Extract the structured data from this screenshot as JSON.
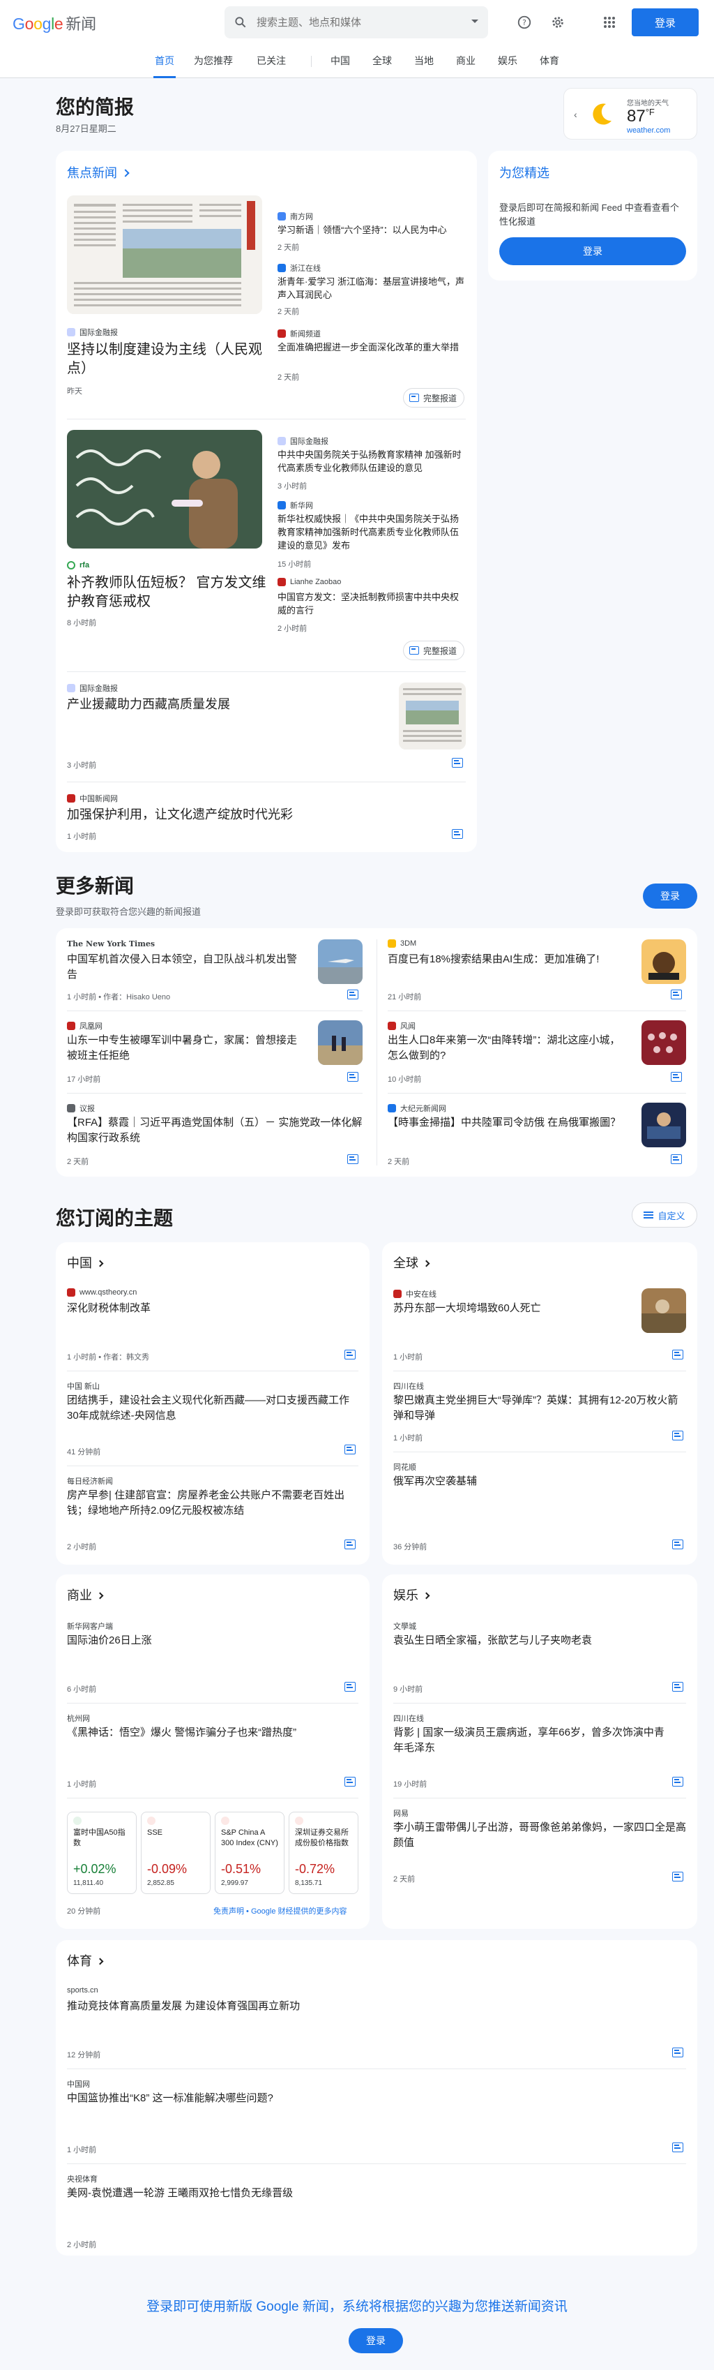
{
  "header": {
    "logo_google": [
      "G",
      "o",
      "o",
      "g",
      "l",
      "e"
    ],
    "logo_news": "新闻",
    "search_placeholder": "搜索主题、地点和媒体",
    "signin": "登录"
  },
  "nav": [
    "首页",
    "为您推荐",
    "已关注",
    "中国",
    "全球",
    "当地",
    "商业",
    "娱乐",
    "体育"
  ],
  "briefing": {
    "title": "您的简报",
    "date": "8月27日星期二"
  },
  "weather": {
    "location": "您当地的天气",
    "temp": "87",
    "unit": "°F",
    "source": "weather.com"
  },
  "top_stories": {
    "link": "焦点新闻",
    "cluster1": {
      "main_source": "国际金融报",
      "main_title": "坚持以制度建设为主线（人民观点）",
      "main_time": "昨天",
      "side": [
        {
          "source": "南方网",
          "title": "学习新语｜领悟“六个坚持”：以人民为中心",
          "time": "2 天前"
        },
        {
          "source": "浙江在线",
          "title": "浙青年·爱学习 浙江临海：基层宣讲接地气，声声入耳润民心",
          "time": "2 天前"
        },
        {
          "source": "新闻频道",
          "title": "全面准确把握进一步全面深化改革的重大举措",
          "time": "2 天前"
        }
      ],
      "coverage": "完整报道"
    },
    "cluster2": {
      "main_source": "rfa",
      "main_title": "补齐教师队伍短板？ 官方发文维护教育惩戒权",
      "main_time": "8 小时前",
      "side": [
        {
          "source": "国际金融报",
          "title": "中共中央国务院关于弘扬教育家精神 加强新时代高素质专业化教师队伍建设的意见",
          "time": "3 小时前"
        },
        {
          "source": "新华网",
          "title": "新华社权威快报｜《中共中央国务院关于弘扬教育家精神加强新时代高素质专业化教师队伍建设的意见》发布",
          "time": "15 小时前"
        },
        {
          "source": "Lianhe Zaobao",
          "title": "中国官方发文：坚决抵制教师损害中共中央权威的言行",
          "time": "2 小时前"
        }
      ],
      "coverage": "完整报道"
    },
    "single1": {
      "source": "国际金融报",
      "title": "产业援藏助力西藏高质量发展",
      "time": "3 小时前"
    },
    "single2": {
      "source": "中国新闻网",
      "title": "加强保护利用，让文化遗产绽放时代光彩",
      "time": "1 小时前"
    }
  },
  "picks": {
    "title": "为您精选",
    "text": "登录后即可在简报和新闻 Feed 中查看查看个性化报道",
    "button": "登录"
  },
  "more_news": {
    "title": "更多新闻",
    "subtitle": "登录即可获取符合您兴趣的新闻报道",
    "button": "登录",
    "items": [
      {
        "source": "The New York Times",
        "title": "中国军机首次侵入日本领空，自卫队战斗机发出警告",
        "time": "1 小时前 • 作者：Hisako Ueno"
      },
      {
        "source": "3DM",
        "title": "百度已有18%搜索结果由AI生成：更加准确了!",
        "time": "21 小时前"
      },
      {
        "source": "凤凰网",
        "title": "山东一中专生被曝军训中暑身亡，家属：曾想接走被班主任拒绝",
        "time": "17 小时前"
      },
      {
        "source": "风闻",
        "title": "出生人口8年来第一次“由降转增”：湖北这座小城，怎么做到的?",
        "time": "10 小时前"
      },
      {
        "source": "议报",
        "title": "【RFA】蔡霞｜习近平再造党国体制（五）－ 实施党政一体化解构国家行政系统",
        "time": "2 天前"
      },
      {
        "source": "大纪元新闻网",
        "title": "【時事金掃描】中共陸軍司令訪俄 在烏俄軍搬圖？",
        "time": "2 天前"
      }
    ]
  },
  "topics": {
    "title": "您订阅的主题",
    "customize": "自定义",
    "china": {
      "title": "中国",
      "items": [
        {
          "source": "www.qstheory.cn",
          "title": "深化财税体制改革",
          "time": "1 小时前 • 作者：韩文秀"
        },
        {
          "source": "中国 新山",
          "title": "团结携手，建设社会主义现代化新西藏——对口支援西藏工作30年成就综述-央网信息",
          "time": "41 分钟前"
        },
        {
          "source": "每日经济新闻",
          "title": "房产早参| 住建部官宣：房屋养老金公共账户不需要老百姓出钱；绿地地产所持2.09亿元股权被冻结",
          "time": "2 小时前"
        }
      ]
    },
    "world": {
      "title": "全球",
      "items": [
        {
          "source": "中安在线",
          "title": "苏丹东部一大坝垮塌致60人死亡",
          "time": "1 小时前"
        },
        {
          "source": "四川在线",
          "title": "黎巴嫩真主党坐拥巨大“导弹库”？英媒：其拥有12-20万枚火箭弹和导弹",
          "time": "1 小时前"
        },
        {
          "source": "同花顺",
          "title": "俄军再次空袭基辅",
          "time": "36 分钟前"
        }
      ]
    },
    "business": {
      "title": "商业",
      "items": [
        {
          "source": "新华网客户端",
          "title": "国际油价26日上涨",
          "time": "6 小时前"
        },
        {
          "source": "杭州网",
          "title": "《黑神话：悟空》爆火 警惕诈骗分子也来“蹭热度”",
          "time": "1 小时前"
        }
      ],
      "stocks": [
        {
          "name": "富时中国A50指数",
          "change": "+0.02%",
          "price": "11,811.40",
          "up": true
        },
        {
          "name": "SSE",
          "change": "-0.09%",
          "price": "2,852.85",
          "up": false
        },
        {
          "name": "S&P China A 300 Index (CNY)",
          "change": "-0.51%",
          "price": "2,999.97",
          "up": false
        },
        {
          "name": "深圳证券交易所成份股价格指数",
          "change": "-0.72%",
          "price": "8,135.71",
          "up": false
        }
      ],
      "stocks_time": "20 分钟前",
      "disclaimer": "免责声明 • Google 财经提供的更多内容"
    },
    "entertainment": {
      "title": "娱乐",
      "items": [
        {
          "source": "文學城",
          "title": "袁弘生日晒全家福，张歆艺与儿子夹吻老袁",
          "time": "9 小时前"
        },
        {
          "source": "四川在线",
          "title": "背影 | 国家一级演员王震病逝，享年66岁，曾多次饰演中青年毛泽东",
          "time": "19 小时前"
        },
        {
          "source": "网易",
          "title": "李小萌王雷带偶儿子出游，哥哥像爸弟弟像妈，一家四口全是高颜值",
          "time": "2 天前"
        }
      ]
    },
    "sports": {
      "title": "体育",
      "items": [
        {
          "source": "sports.cn",
          "title": "推动竞技体育高质量发展 为建设体育强国再立新功",
          "time": "12 分钟前"
        },
        {
          "source": "中国网",
          "title": "中国篮协推出“K8” 这一标准能解决哪些问题?",
          "time": "1 小时前"
        },
        {
          "source": "央视体育",
          "title": "美网-袁悦遭遇一轮游 王曦雨双抢七惜负无缘晋级",
          "time": "2 小时前"
        }
      ]
    }
  },
  "footer": {
    "text": "登录即可使用新版 Google 新闻，系统将根据您的兴趣为您推送新闻资讯",
    "button": "登录"
  },
  "colors": {
    "accent": "#1a73e8",
    "up": "#188038",
    "down": "#c5221f"
  }
}
